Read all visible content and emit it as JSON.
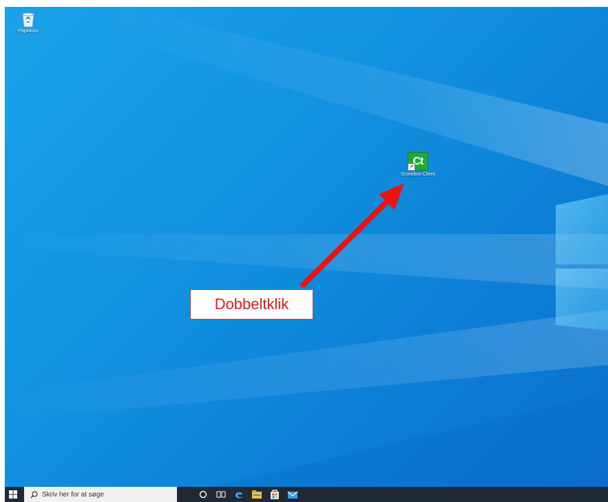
{
  "desktop": {
    "icons": [
      {
        "label": "Papirkurv",
        "icon": "recycle-bin-icon"
      },
      {
        "label": "Scorebox Client",
        "icon": "scorebox-ct-icon",
        "glyph": "Ct"
      }
    ]
  },
  "annotation": {
    "callout_text": "Dobbeltklik",
    "color": "#e01b1b"
  },
  "taskbar": {
    "search_placeholder": "Skriv her for at søge",
    "icons": [
      "windows-start-icon",
      "search-icon",
      "cortana-icon",
      "task-view-icon",
      "edge-icon",
      "file-explorer-icon",
      "store-icon",
      "mail-icon"
    ]
  }
}
